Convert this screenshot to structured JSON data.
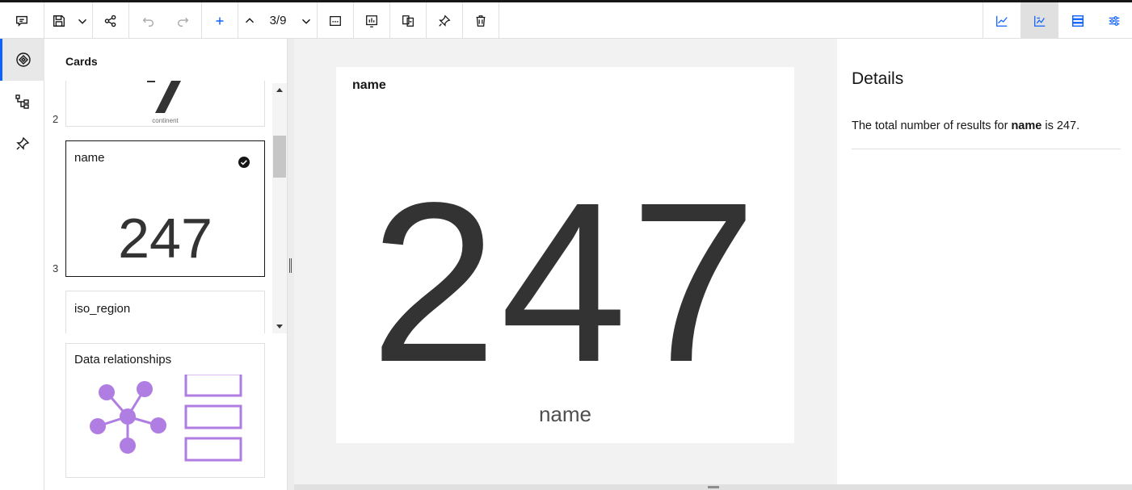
{
  "toolbar": {
    "page_counter": "3/9"
  },
  "cards_panel": {
    "title": "Cards",
    "cards": [
      {
        "index": "2",
        "caption": "continent"
      },
      {
        "index": "3",
        "label": "name",
        "value": "247"
      },
      {
        "label": "iso_region"
      },
      {
        "label": "Data relationships"
      }
    ]
  },
  "main_card": {
    "title": "name",
    "value": "247",
    "caption": "name"
  },
  "details": {
    "title": "Details",
    "text_prefix": "The total number of results for ",
    "text_field": "name",
    "text_suffix": " is 247."
  },
  "colors": {
    "accent": "#0f62fe",
    "relationship_purple": "#b07ee2"
  }
}
